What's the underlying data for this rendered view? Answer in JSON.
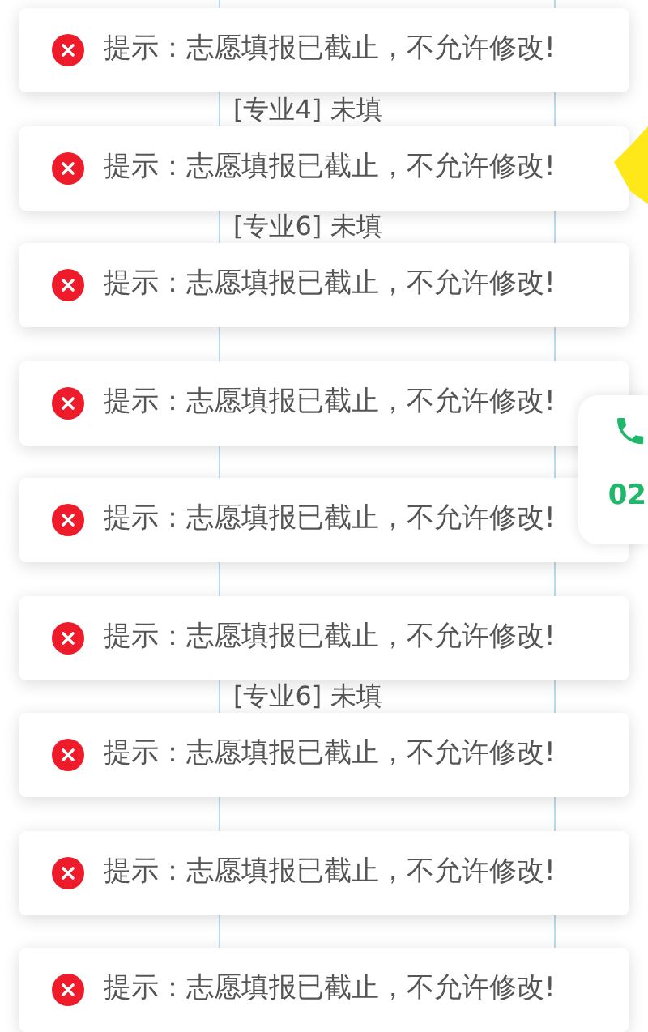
{
  "background": {
    "labels": [
      {
        "text": "[专业4] 未填"
      },
      {
        "text": "[专业6] 未填"
      },
      {
        "text": "[专业6] 未填"
      }
    ]
  },
  "call_widget": {
    "text": "02"
  },
  "toasts": [
    {
      "message": "提示：志愿填报已截止，不允许修改!"
    },
    {
      "message": "提示：志愿填报已截止，不允许修改!"
    },
    {
      "message": "提示：志愿填报已截止，不允许修改!"
    },
    {
      "message": "提示：志愿填报已截止，不允许修改!"
    },
    {
      "message": "提示：志愿填报已截止，不允许修改!"
    },
    {
      "message": "提示：志愿填报已截止，不允许修改!"
    },
    {
      "message": "提示：志愿填报已截止，不允许修改!"
    },
    {
      "message": "提示：志愿填报已截止，不允许修改!"
    },
    {
      "message": "提示：志愿填报已截止，不允许修改!"
    }
  ]
}
